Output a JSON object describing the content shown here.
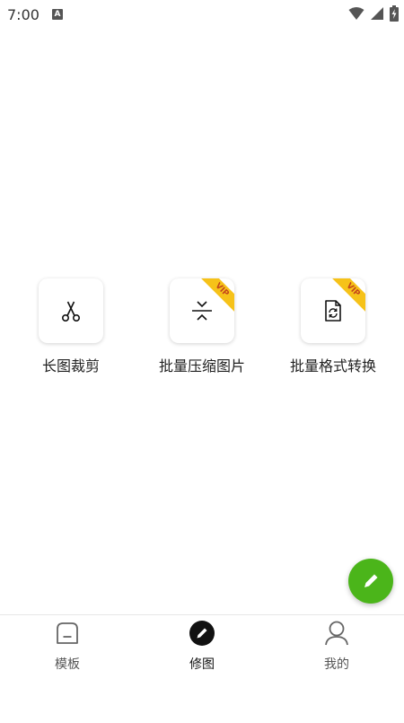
{
  "status_bar": {
    "time": "7:00",
    "notification_icon": "A",
    "icons": [
      "wifi-icon",
      "cell-signal-icon",
      "battery-charging-icon"
    ]
  },
  "tools": [
    {
      "label": "长图裁剪",
      "icon": "scissors-icon",
      "vip": false
    },
    {
      "label": "批量压缩图片",
      "icon": "compress-icon",
      "vip": true,
      "badge": "VIP"
    },
    {
      "label": "批量格式转换",
      "icon": "file-convert-icon",
      "vip": true,
      "badge": "VIP"
    }
  ],
  "fab": {
    "icon": "pencil-icon",
    "color": "#4bb51a"
  },
  "bottom_nav": {
    "items": [
      {
        "label": "模板",
        "icon": "template-icon",
        "active": false
      },
      {
        "label": "修图",
        "icon": "edit-circle-icon",
        "active": true
      },
      {
        "label": "我的",
        "icon": "user-icon",
        "active": false
      }
    ]
  },
  "colors": {
    "accent": "#4bb51a",
    "vip": "#f6c219"
  }
}
